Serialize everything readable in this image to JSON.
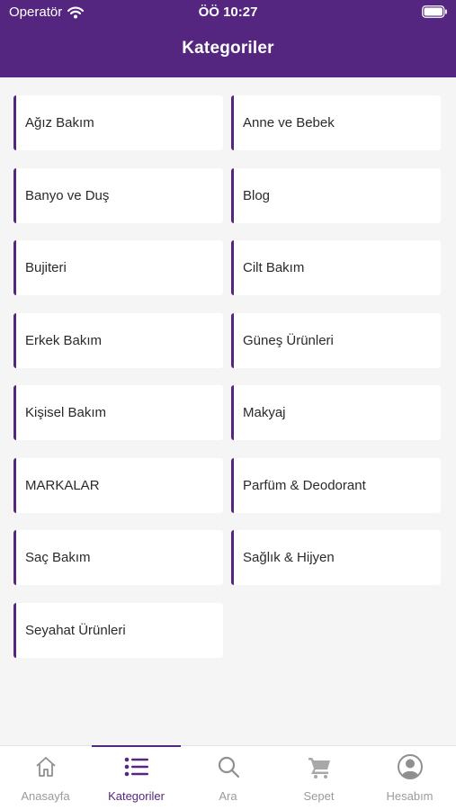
{
  "status_bar": {
    "carrier": "Operatör",
    "time": "ÖÖ 10:27"
  },
  "header": {
    "title": "Kategoriler"
  },
  "categories": [
    "Ağız Bakım",
    "Anne ve Bebek",
    "Banyo ve Duş",
    "Blog",
    "Bujiteri",
    "Cilt Bakım",
    "Erkek Bakım",
    "Güneş Ürünleri",
    "Kişisel Bakım",
    "Makyaj",
    "MARKALAR",
    "Parfüm & Deodorant",
    "Saç Bakım",
    "Sağlık & Hijyen",
    "Seyahat Ürünleri"
  ],
  "tabs": [
    {
      "label": "Anasayfa",
      "icon": "home-icon"
    },
    {
      "label": "Kategoriler",
      "icon": "list-icon",
      "active": true
    },
    {
      "label": "Ara",
      "icon": "search-icon"
    },
    {
      "label": "Sepet",
      "icon": "cart-icon"
    },
    {
      "label": "Hesabım",
      "icon": "account-icon"
    }
  ],
  "colors": {
    "brand": "#55267f",
    "inactive": "#9b9b9b",
    "background": "#f5f5f5"
  }
}
